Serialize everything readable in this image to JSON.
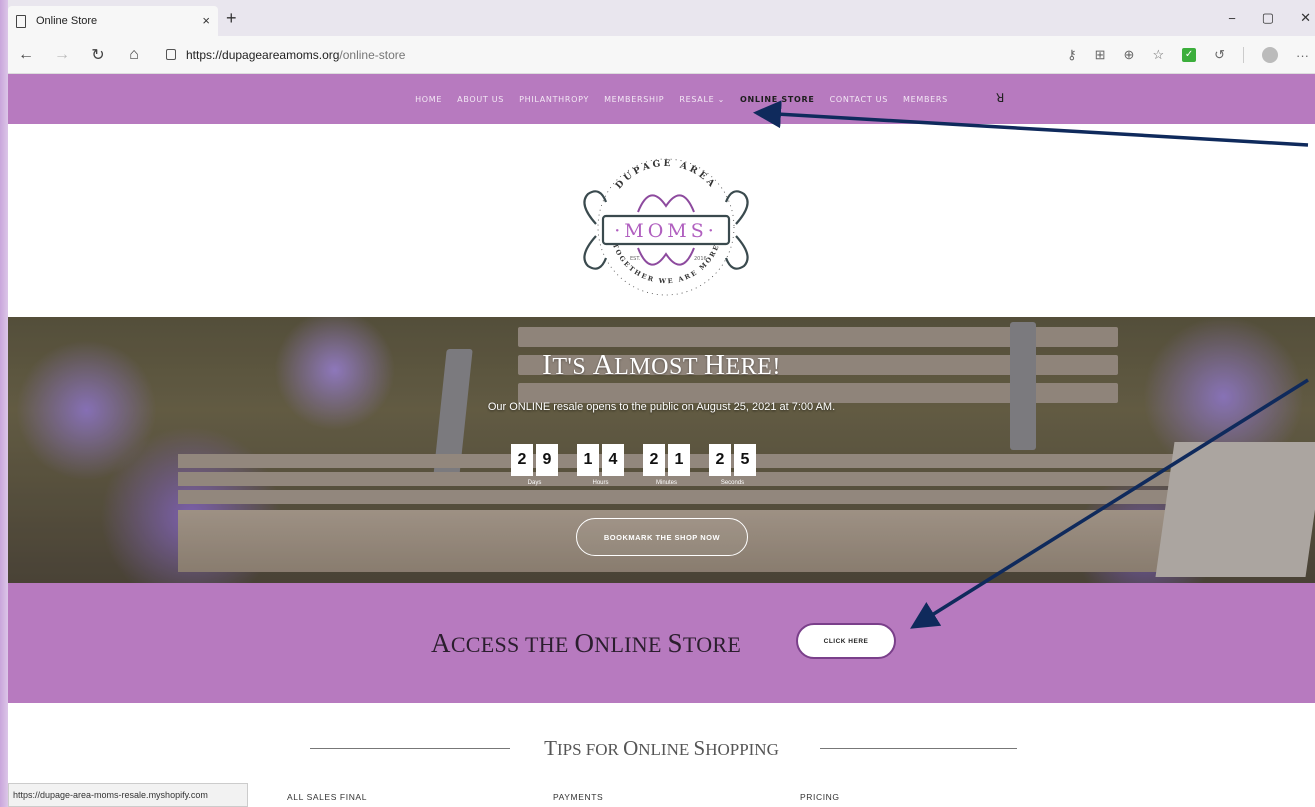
{
  "browser": {
    "tab_title": "Online Store",
    "tab_close": "×",
    "new_tab": "+",
    "window_controls": [
      "−",
      "▢",
      "✕"
    ],
    "url_host": "https://dupageareamoms.org",
    "url_path": "/online-store",
    "status_url": "https://dupage-area-moms-resale.myshopify.com"
  },
  "nav": {
    "items": [
      "HOME",
      "ABOUT US",
      "PHILANTHROPY",
      "MEMBERSHIP",
      "RESALE ⌄",
      "ONLINE STORE",
      "CONTACT US",
      "MEMBERS"
    ],
    "user_icon": "ꓤ"
  },
  "logo": {
    "top_text": "DUPAGE AREA",
    "center_text": "·MOMS·",
    "est_left": "EST.",
    "est_right": "2016",
    "bottom_text": "TOGETHER WE ARE MORE"
  },
  "hero": {
    "title_first": "I",
    "title_rest_1": "T'S ",
    "title_cap_2": "A",
    "title_rest_2": "LMOST ",
    "title_cap_3": "H",
    "title_rest_3": "ERE!",
    "subtitle": "Our ONLINE resale opens to the public on August 25, 2021 at 7:00 AM.",
    "countdown": {
      "days": [
        "2",
        "9"
      ],
      "hours": [
        "1",
        "4"
      ],
      "minutes": [
        "2",
        "1"
      ],
      "seconds": [
        "2",
        "5"
      ],
      "labels": [
        "Days",
        "Hours",
        "Minutes",
        "Seconds"
      ]
    },
    "bookmark_label": "BOOKMARK THE SHOP NOW"
  },
  "access": {
    "text_cap_1": "A",
    "text_1": "CCESS THE ",
    "text_cap_2": "O",
    "text_2": "NLINE ",
    "text_cap_3": "S",
    "text_3": "TORE",
    "button_label": "CLICK HERE"
  },
  "tips": {
    "heading_cap_1": "T",
    "heading_1": "IPS FOR ",
    "heading_cap_2": "O",
    "heading_2": "NLINE ",
    "heading_cap_3": "S",
    "heading_3": "HOPPING",
    "columns": [
      "ALL SALES FINAL",
      "PAYMENTS",
      "PRICING"
    ]
  },
  "colors": {
    "brand_purple": "#b77abf",
    "arrow_navy": "#0f2a5c"
  }
}
